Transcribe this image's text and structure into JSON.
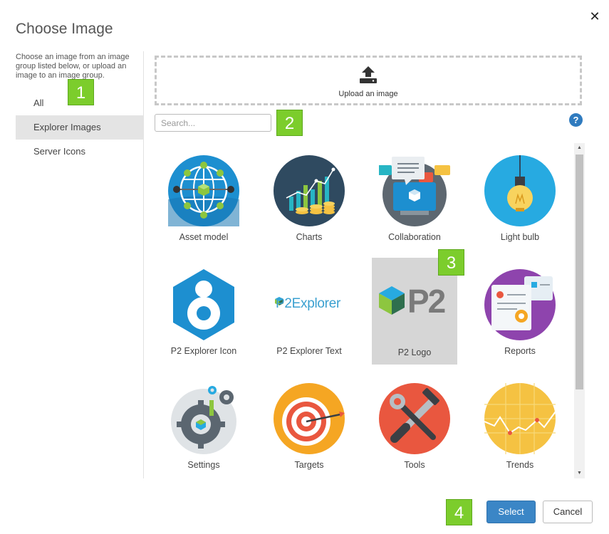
{
  "dialog": {
    "title": "Choose Image",
    "close_label": "✕"
  },
  "sidebar": {
    "description": "Choose an image from an image group listed below, or upload an image to an image group.",
    "items": [
      {
        "label": "All",
        "selected": false
      },
      {
        "label": "Explorer Images",
        "selected": true
      },
      {
        "label": "Server Icons",
        "selected": false
      }
    ]
  },
  "upload": {
    "label": "Upload an image",
    "icon": "upload-icon"
  },
  "search": {
    "placeholder": "Search...",
    "value": ""
  },
  "help": {
    "label": "?"
  },
  "gallery": {
    "items": [
      {
        "label": "Asset model",
        "icon": "asset-model-icon"
      },
      {
        "label": "Charts",
        "icon": "charts-icon"
      },
      {
        "label": "Collaboration",
        "icon": "collaboration-icon"
      },
      {
        "label": "Light bulb",
        "icon": "light-bulb-icon"
      },
      {
        "label": "P2 Explorer Icon",
        "icon": "p2-explorer-icon"
      },
      {
        "label": "P2 Explorer Text",
        "icon": "p2-explorer-text-logo",
        "logo_text": "P2Explorer"
      },
      {
        "label": "P2 Logo",
        "icon": "p2-logo",
        "logo_text": "P2",
        "selected": true
      },
      {
        "label": "Reports",
        "icon": "reports-icon"
      },
      {
        "label": "Settings",
        "icon": "settings-icon"
      },
      {
        "label": "Targets",
        "icon": "targets-icon"
      },
      {
        "label": "Tools",
        "icon": "tools-icon"
      },
      {
        "label": "Trends",
        "icon": "trends-icon"
      }
    ]
  },
  "callouts": [
    "1",
    "2",
    "3",
    "4"
  ],
  "footer": {
    "select_label": "Select",
    "cancel_label": "Cancel"
  },
  "colors": {
    "accent": "#3b86c6",
    "callout": "#7ccd2c",
    "selected_bg": "#d6d6d6"
  }
}
